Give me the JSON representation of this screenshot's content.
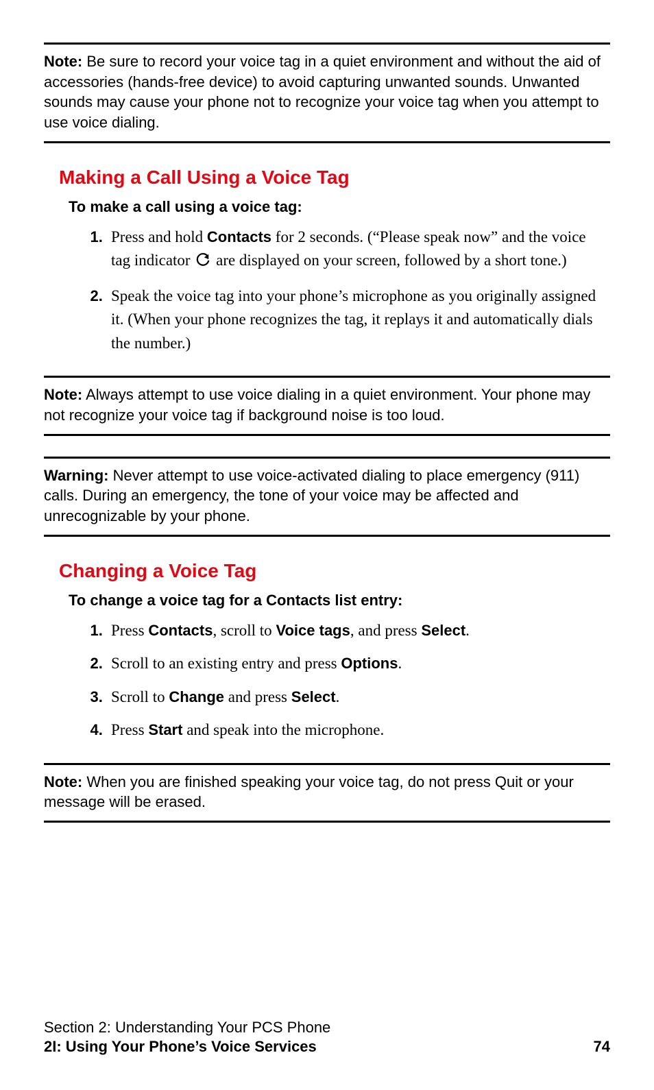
{
  "notes": {
    "n1": {
      "label": "Note:",
      "text": " Be sure to record your voice tag in a quiet environment and without the aid of accessories (hands-free device) to avoid capturing unwanted sounds. Unwanted sounds may cause your phone not to recognize your voice tag when you attempt to use voice dialing."
    },
    "n2": {
      "label": "Note:",
      "text": " Always attempt to use voice dialing in a quiet environment. Your phone may not recognize your voice tag if background noise is too loud."
    },
    "n3": {
      "label": "Warning:",
      "text": " Never attempt to use voice-activated dialing to place emergency (911) calls. During an emergency, the tone of your voice may be affected and unrecognizable by your phone."
    },
    "n4": {
      "label": "Note:",
      "text": " When you are finished speaking your voice tag, do not press Quit or your message will be erased."
    }
  },
  "section1": {
    "heading": "Making a Call Using a Voice Tag",
    "subhead": "To make a call using a voice tag:",
    "step1": {
      "pre": "Press and hold ",
      "contacts": "Contacts",
      "post1": " for 2 seconds. (“Please speak now” and the voice tag indicator ",
      "post2": " are displayed on your screen, followed by a short tone.)"
    },
    "step2": "Speak the voice tag into your phone’s microphone as you originally assigned it. (When your phone recognizes the tag, it replays it and automatically dials the number.)"
  },
  "section2": {
    "heading": "Changing a Voice Tag",
    "subhead": "To change a voice tag for a Contacts list entry:",
    "s1": {
      "a": "Press ",
      "b1": "Contacts",
      "c": ", scroll to ",
      "b2": "Voice tags",
      "d": ", and press ",
      "b3": "Select",
      "e": "."
    },
    "s2": {
      "a": "Scroll to an existing entry and press ",
      "b1": "Options",
      "e": "."
    },
    "s3": {
      "a": "Scroll to ",
      "b1": "Change",
      "c": " and press ",
      "b2": "Select",
      "e": "."
    },
    "s4": {
      "a": "Press ",
      "b1": "Start",
      "c": " and speak into the microphone."
    }
  },
  "footer": {
    "line1": "Section 2: Understanding Your PCS Phone",
    "line2": "2I: Using Your Phone’s Voice Services",
    "page": "74"
  }
}
